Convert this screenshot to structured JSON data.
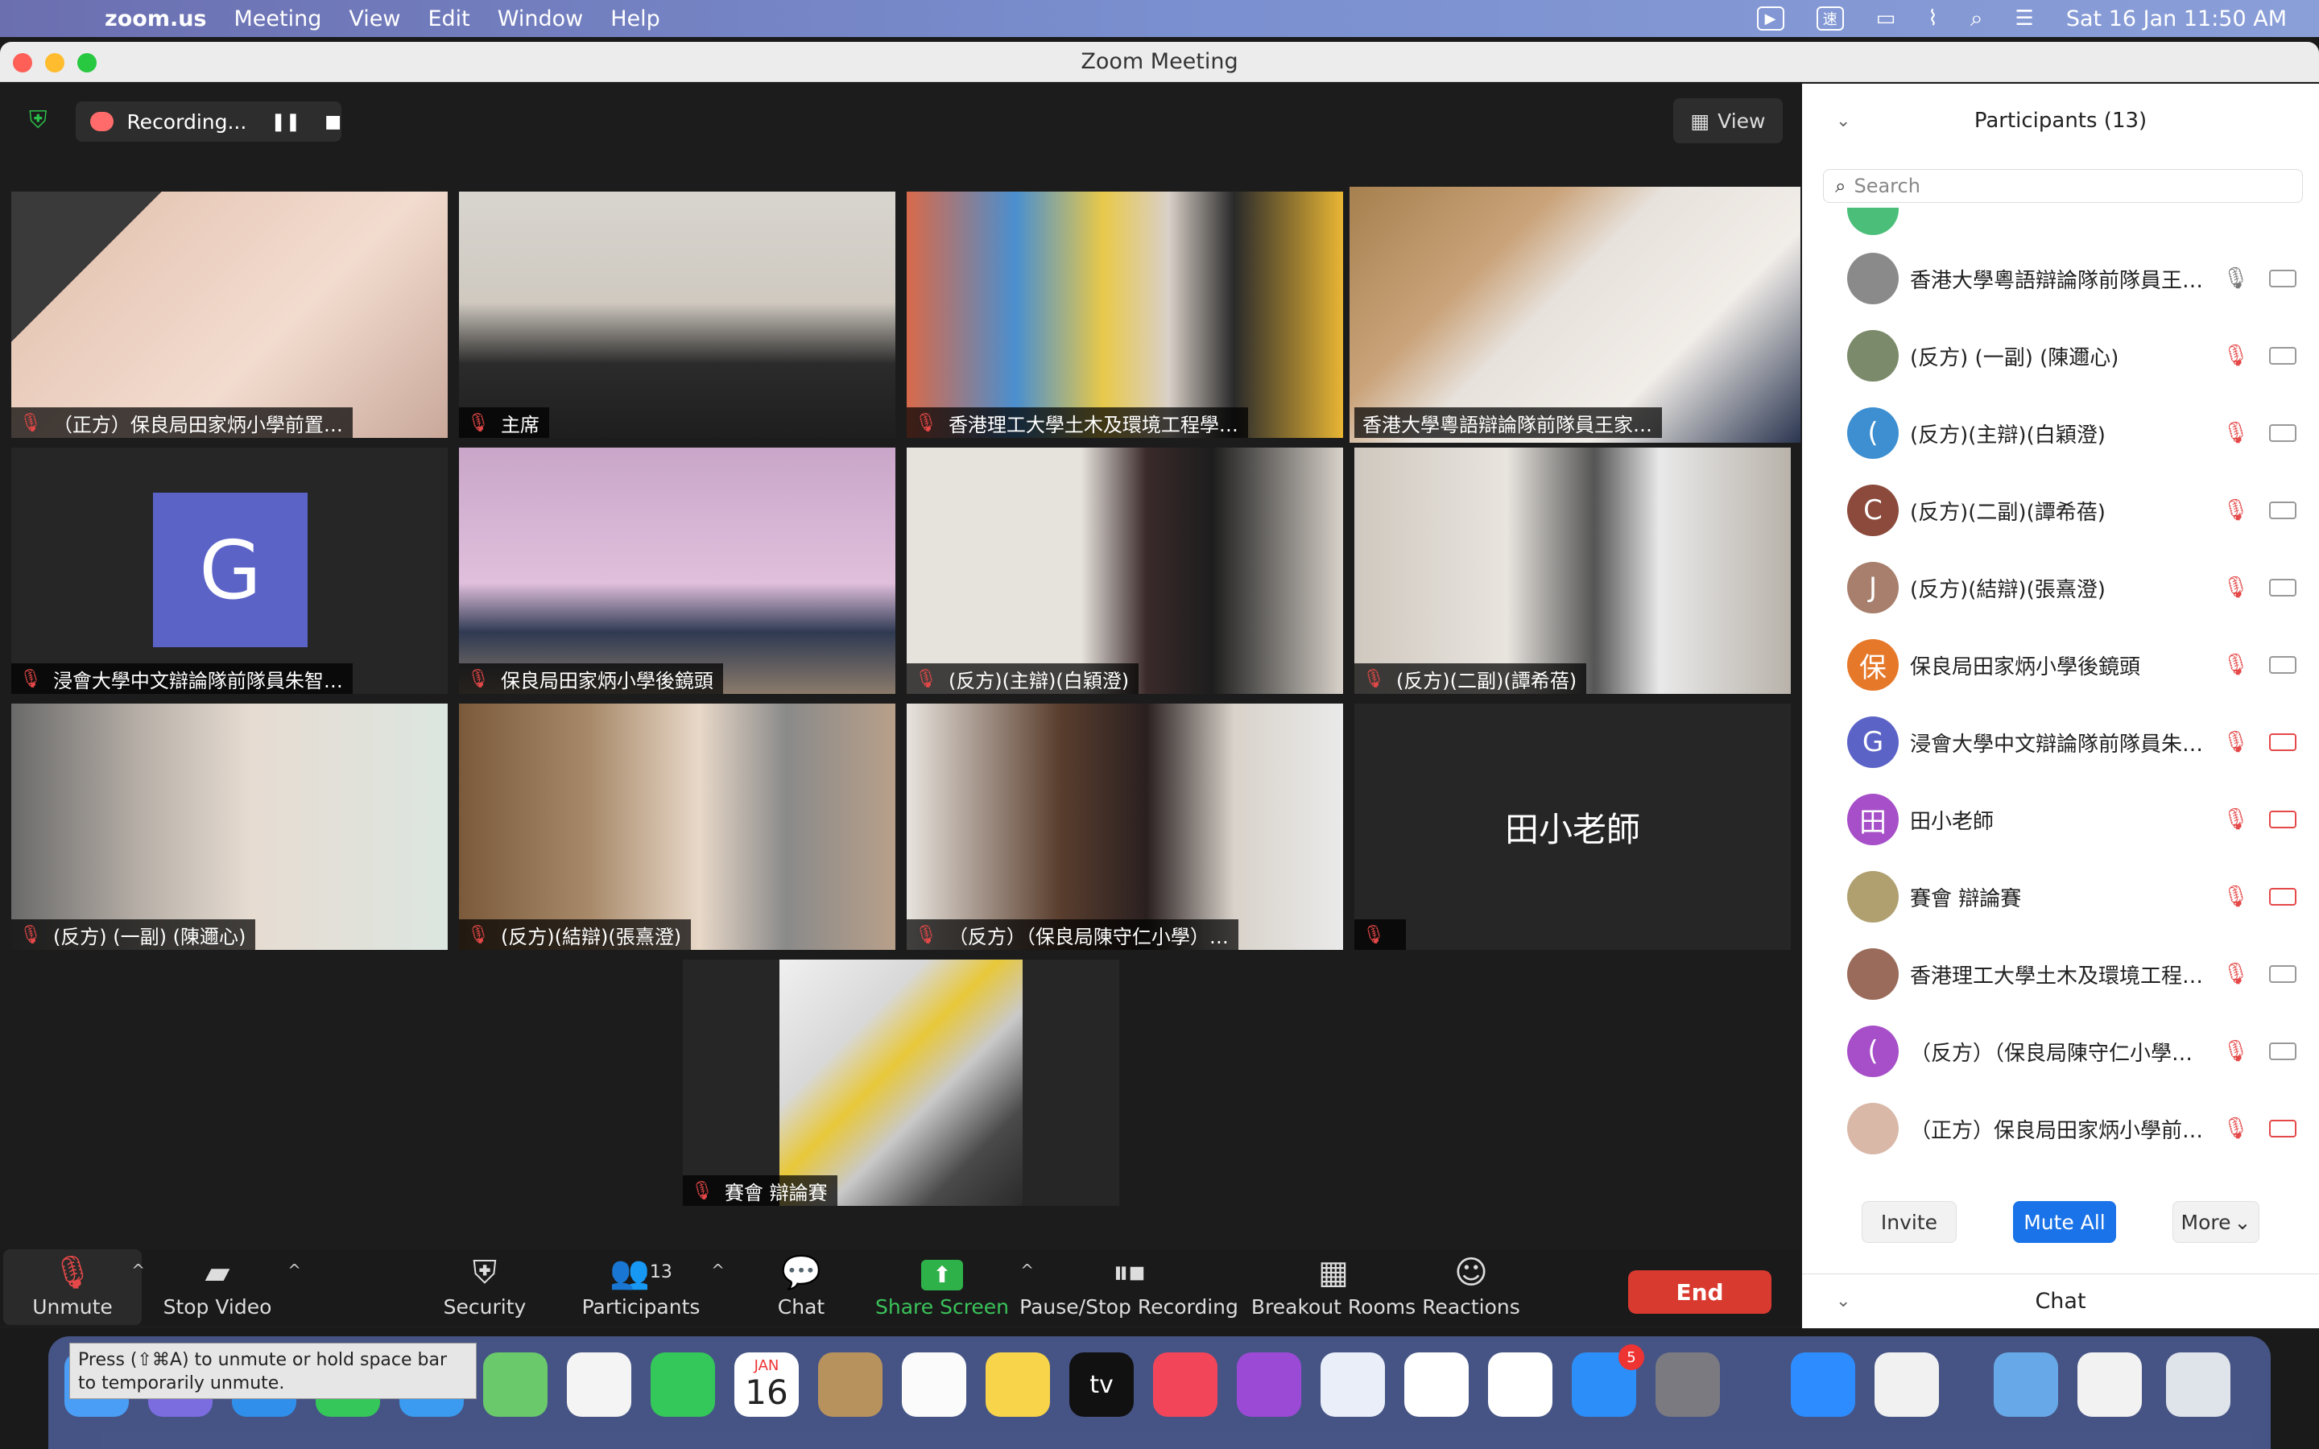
{
  "menubar": {
    "app_name": "zoom.us",
    "menus": [
      "Meeting",
      "View",
      "Edit",
      "Window",
      "Help"
    ],
    "datetime": "Sat 16 Jan  11:50 AM",
    "input_method": "速"
  },
  "window": {
    "title": "Zoom Meeting"
  },
  "meeting": {
    "recording_label": "Recording...",
    "view_label": "View",
    "tiles": [
      {
        "name": "（正方）保良局田家炳小學前置…"
      },
      {
        "name": "主席"
      },
      {
        "name": "香港理工大學土木及環境工程學…"
      },
      {
        "name": "香港大學粵語辯論隊前隊員王家…"
      },
      {
        "name": "浸會大學中文辯論隊前隊員朱智…",
        "avatar_letter": "G"
      },
      {
        "name": "保良局田家炳小學後鏡頭"
      },
      {
        "name": "(反方)(主辯)(白穎澄)"
      },
      {
        "name": "(反方)(二副)(譚希蓓)"
      },
      {
        "name": "(反方) (一副) (陳邇心)"
      },
      {
        "name": "(反方)(結辯)(張熹澄)"
      },
      {
        "name": "（反方）（保良局陳守仁小學）…"
      },
      {
        "name": "",
        "big_name": "田小老師"
      },
      {
        "name": "賽會 辯論賽"
      }
    ]
  },
  "toolbar": {
    "unmute": "Unmute",
    "stop_video": "Stop Video",
    "security": "Security",
    "participants": "Participants",
    "participants_count": "13",
    "chat": "Chat",
    "share_screen": "Share Screen",
    "pause_stop_recording": "Pause/Stop Recording",
    "breakout_rooms": "Breakout Rooms",
    "reactions": "Reactions",
    "end": "End"
  },
  "panel": {
    "title": "Participants (13)",
    "search_placeholder": "Search",
    "participants": [
      {
        "name": "香港大學粵語辯論隊前隊員王…",
        "avatar": "",
        "color": "#8a8a8a"
      },
      {
        "name": "(反方) (一副) (陳邇心)",
        "avatar": "",
        "color": "#7b8a6a"
      },
      {
        "name": "(反方)(主辯)(白穎澄)",
        "avatar": "(",
        "color": "#3d8fd1"
      },
      {
        "name": "(反方)(二副)(譚希蓓)",
        "avatar": "C",
        "color": "#8b4a3c"
      },
      {
        "name": "(反方)(結辯)(張熹澄)",
        "avatar": "J",
        "color": "#a77f6c"
      },
      {
        "name": "保良局田家炳小學後鏡頭",
        "avatar": "保",
        "color": "#e6782a"
      },
      {
        "name": "浸會大學中文辯論隊前隊員朱…",
        "avatar": "G",
        "color": "#5b63c7"
      },
      {
        "name": "田小老師",
        "avatar": "田",
        "color": "#a64fc8"
      },
      {
        "name": "賽會 辯論賽",
        "avatar": "",
        "color": "#b0a070"
      },
      {
        "name": "香港理工大學土木及環境工程…",
        "avatar": "",
        "color": "#9a6a5a"
      },
      {
        "name": "（反方）（保良局陳守仁小學…",
        "avatar": "(",
        "color": "#a64fc8"
      },
      {
        "name": "（正方）保良局田家炳小學前…",
        "avatar": "",
        "color": "#d9b8a8"
      }
    ],
    "invite": "Invite",
    "mute_all": "Mute All",
    "more": "More",
    "chat": "Chat"
  },
  "tooltip": {
    "text": "Press  (⇧⌘A) to unmute or hold space bar to temporarily unmute."
  },
  "dock": {
    "calendar_month": "JAN",
    "calendar_day": "16",
    "appstore_badge": "5"
  }
}
